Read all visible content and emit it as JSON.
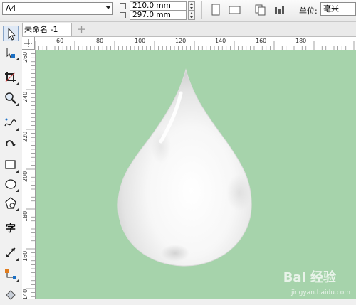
{
  "property_bar": {
    "paper_size": "A4",
    "width_value": "210.0 mm",
    "height_value": "297.0 mm",
    "unit_label": "单位:",
    "unit_value": "毫米"
  },
  "document_tabs": [
    {
      "label": "未命名 -1"
    }
  ],
  "add_tab_label": "+",
  "rulers": {
    "horizontal_ticks": [
      "60",
      "80",
      "100",
      "120",
      "140",
      "160",
      "180"
    ],
    "vertical_ticks": [
      "260",
      "240",
      "220",
      "200",
      "180",
      "160",
      "140"
    ]
  },
  "toolbox_tools": [
    {
      "name": "pick-tool",
      "icon": "arrow-cursor-icon"
    },
    {
      "name": "shape-tool",
      "icon": "shape-node-icon"
    },
    {
      "name": "crop-tool",
      "icon": "crop-icon"
    },
    {
      "name": "zoom-tool",
      "icon": "magnifier-icon"
    },
    {
      "name": "freehand-tool",
      "icon": "freehand-icon"
    },
    {
      "name": "smart-drawing-tool",
      "icon": "smart-draw-icon"
    },
    {
      "name": "rectangle-tool",
      "icon": "rectangle-icon"
    },
    {
      "name": "ellipse-tool",
      "icon": "ellipse-icon"
    },
    {
      "name": "polygon-tool",
      "icon": "polygon-icon"
    },
    {
      "name": "text-tool",
      "icon": "text-icon",
      "label": "字"
    },
    {
      "name": "dimension-tool",
      "icon": "dimension-icon"
    },
    {
      "name": "connector-tool",
      "icon": "connector-icon"
    }
  ],
  "watermark": {
    "text": "Bai 经验",
    "url": "jingyan.baidu.com"
  },
  "colors": {
    "canvas_bg": "#a6d3ab",
    "drop_fill": "#f4f4f4"
  }
}
